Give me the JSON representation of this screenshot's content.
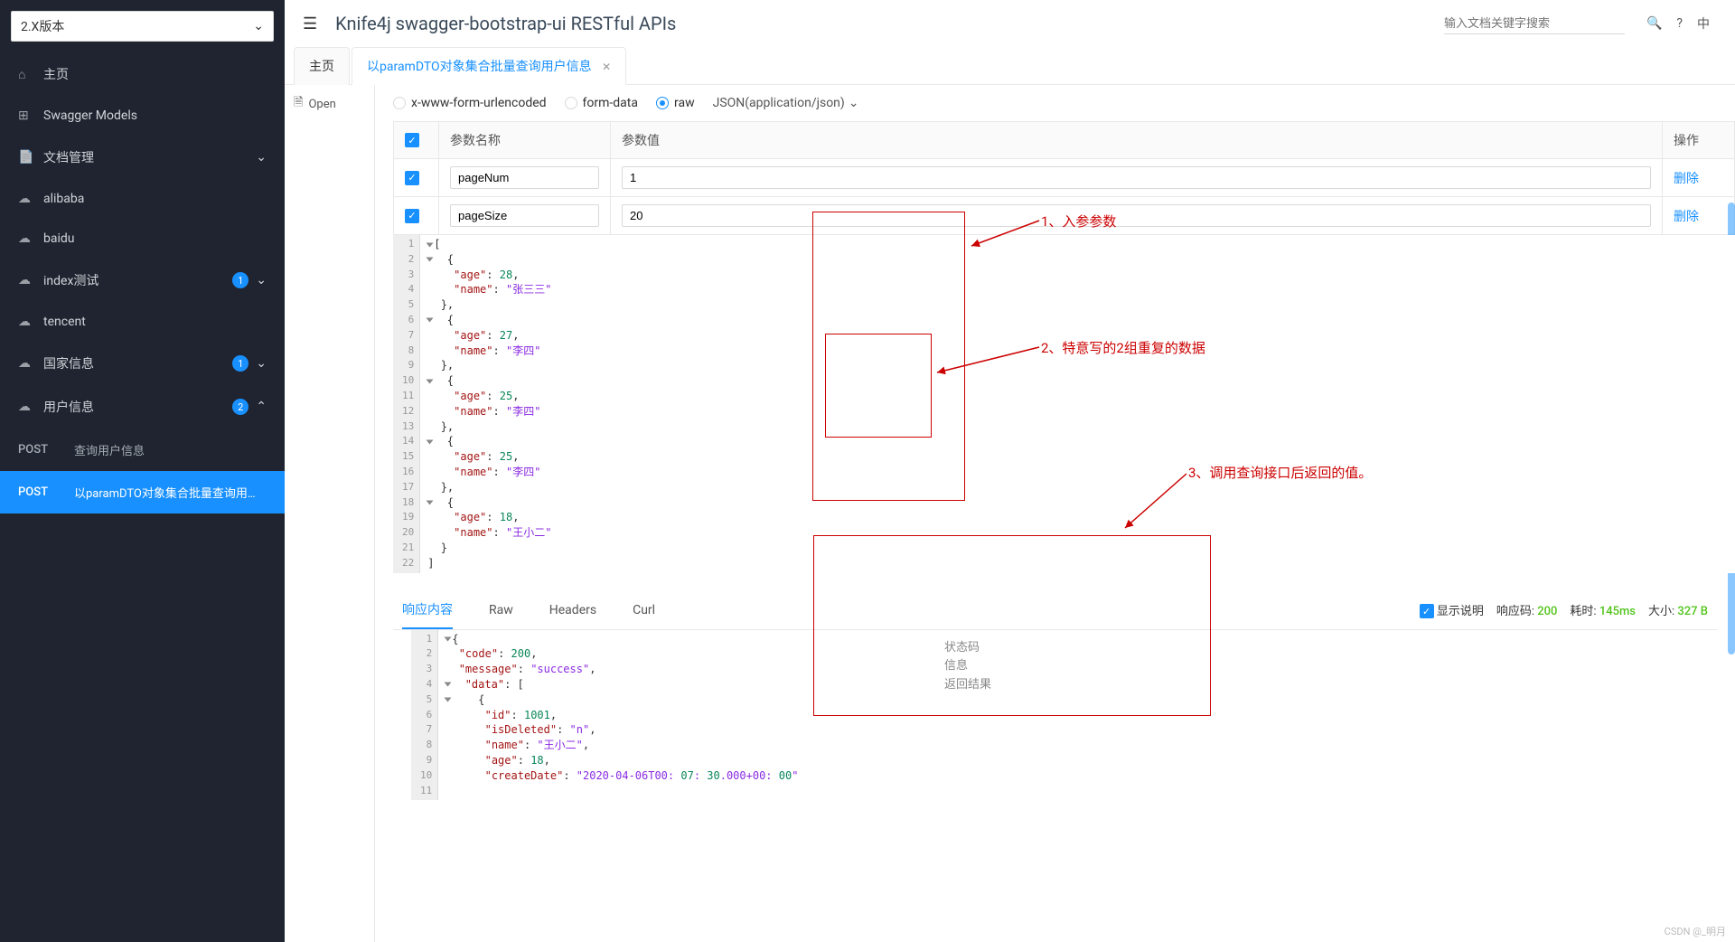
{
  "version": "2.X版本",
  "sidebar": {
    "home": "主页",
    "swagger_models": "Swagger Models",
    "doc_manage": "文档管理",
    "groups": [
      {
        "label": "alibaba"
      },
      {
        "label": "baidu"
      },
      {
        "label": "index测试",
        "badge": "1"
      },
      {
        "label": "tencent"
      },
      {
        "label": "国家信息",
        "badge": "1"
      },
      {
        "label": "用户信息",
        "badge": "2",
        "expanded": true
      }
    ],
    "user_apis": [
      {
        "method": "POST",
        "label": "查询用户信息"
      },
      {
        "method": "POST",
        "label": "以paramDTO对象集合批量查询用户信息",
        "active": true
      }
    ]
  },
  "header": {
    "title": "Knife4j swagger-bootstrap-ui RESTful APIs",
    "search_placeholder": "输入文档关键字搜索",
    "lang": "中"
  },
  "tabs": [
    {
      "label": "主页"
    },
    {
      "label": "以paramDTO对象集合批量查询用户信息",
      "active": true,
      "closable": true
    }
  ],
  "side_link": "Open",
  "content_types": {
    "xwww": "x-www-form-urlencoded",
    "formdata": "form-data",
    "raw": "raw",
    "json": "JSON(application/json)"
  },
  "params": {
    "header_name": "参数名称",
    "header_value": "参数值",
    "header_action": "操作",
    "delete_label": "删除",
    "rows": [
      {
        "name": "pageNum",
        "value": "1"
      },
      {
        "name": "pageSize",
        "value": "20"
      }
    ]
  },
  "request_body": [
    "[",
    "  {",
    "    \"age\": 28,",
    "    \"name\": \"张三三\"",
    "  },",
    "  {",
    "    \"age\": 27,",
    "    \"name\": \"李四\"",
    "  },",
    "  {",
    "    \"age\": 25,",
    "    \"name\": \"李四\"",
    "  },",
    "  {",
    "    \"age\": 25,",
    "    \"name\": \"李四\"",
    "  },",
    "  {",
    "    \"age\": 18,",
    "    \"name\": \"王小二\"",
    "  }",
    "]"
  ],
  "response_tabs": {
    "content": "响应内容",
    "raw": "Raw",
    "headers": "Headers",
    "curl": "Curl"
  },
  "response_info": {
    "show_desc": "显示说明",
    "code_label": "响应码:",
    "code_value": "200",
    "time_label": "耗时:",
    "time_value": "145ms",
    "size_label": "大小:",
    "size_value": "327 B"
  },
  "response_body": [
    "{",
    "  \"code\": 200,",
    "  \"message\": \"success\",",
    "  \"data\": [",
    "    {",
    "      \"id\": 1001,",
    "      \"isDeleted\": \"n\",",
    "      \"name\": \"王小二\",",
    "      \"age\": 18,",
    "      \"createDate\": \"2020-04-06T00:07:30.000+00:00\"",
    "    "
  ],
  "response_desc": {
    "l1": "状态码",
    "l2": "信息",
    "l3": "返回结果"
  },
  "annotations": {
    "a1": "1、入参参数",
    "a2": "2、特意写的2组重复的数据",
    "a3": "3、调用查询接口后返回的值。"
  },
  "watermark": "CSDN @_明月"
}
